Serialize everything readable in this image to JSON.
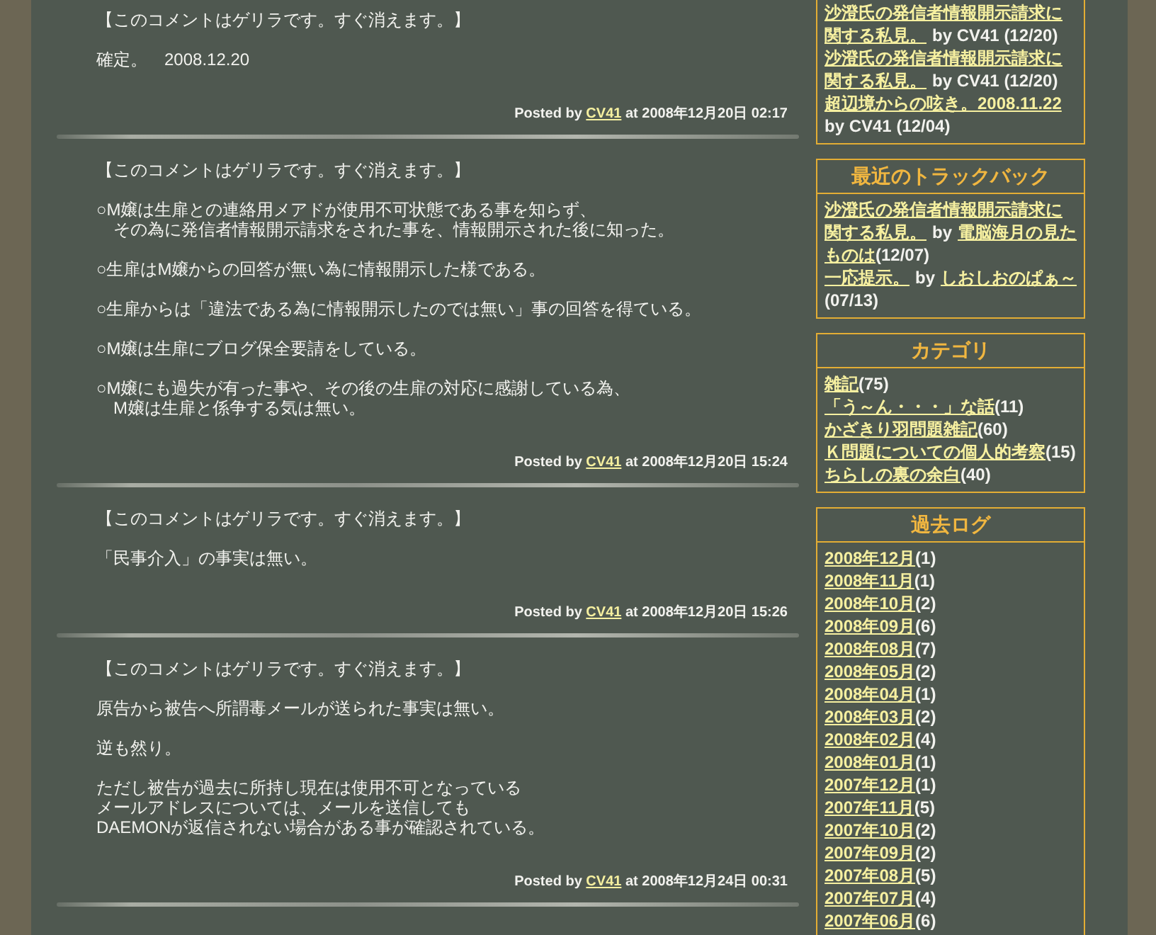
{
  "comments": [
    {
      "paragraphs": [
        [
          "【このコメントはゲリラです。すぐ消えます。】"
        ],
        [
          "確定。　2008.12.20"
        ]
      ],
      "footer": {
        "prefix": "Posted by",
        "author": "CV41",
        "suffix": "at 2008年12月20日 02:17"
      }
    },
    {
      "paragraphs": [
        [
          "【このコメントはゲリラです。すぐ消えます。】"
        ],
        [
          "○M嬢は生扉との連絡用メアドが使用不可状態である事を知らず、",
          "　その為に発信者情報開示請求をされた事を、情報開示された後に知った。"
        ],
        [
          "○生扉はM嬢からの回答が無い為に情報開示した様である。"
        ],
        [
          "○生扉からは「違法である為に情報開示したのでは無い」事の回答を得ている。"
        ],
        [
          "○M嬢は生扉にブログ保全要請をしている。"
        ],
        [
          "○M嬢にも過失が有った事や、その後の生扉の対応に感謝している為、",
          "　M嬢は生扉と係争する気は無い。"
        ]
      ],
      "footer": {
        "prefix": "Posted by",
        "author": "CV41",
        "suffix": "at 2008年12月20日 15:24"
      }
    },
    {
      "paragraphs": [
        [
          "【このコメントはゲリラです。すぐ消えます。】"
        ],
        [
          "「民事介入」の事実は無い。"
        ]
      ],
      "footer": {
        "prefix": "Posted by",
        "author": "CV41",
        "suffix": "at 2008年12月20日 15:26"
      }
    },
    {
      "paragraphs": [
        [
          "【このコメントはゲリラです。すぐ消えます。】"
        ],
        [
          "原告から被告へ所謂毒メールが送られた事実は無い。"
        ],
        [
          "逆も然り。"
        ],
        [
          "ただし被告が過去に所持し現在は使用不可となっている",
          "メールアドレスについては、メールを送信しても",
          "DAEMONが返信されない場合がある事が確認されている。"
        ]
      ],
      "footer": {
        "prefix": "Posted by",
        "author": "CV41",
        "suffix": "at 2008年12月24日 00:31"
      }
    }
  ],
  "sidebar": {
    "recent_comments": [
      {
        "lines": [
          [
            {
              "kind": "link",
              "text": "沙澄氏の発信者情報開示請求に"
            }
          ],
          [
            {
              "kind": "link",
              "text": "関する私見。"
            },
            {
              "kind": "text",
              "text": "by CV41 (12/20)"
            }
          ]
        ]
      },
      {
        "lines": [
          [
            {
              "kind": "link",
              "text": "沙澄氏の発信者情報開示請求に"
            }
          ],
          [
            {
              "kind": "link",
              "text": "関する私見。"
            },
            {
              "kind": "text",
              "text": "by CV41 (12/20)"
            }
          ]
        ]
      },
      {
        "lines": [
          [
            {
              "kind": "link",
              "text": "超辺境からの呟き。2008.11.22"
            }
          ],
          [
            {
              "kind": "text",
              "text": "by CV41 (12/04)"
            }
          ]
        ]
      }
    ],
    "trackbacks": {
      "title": "最近のトラックバック",
      "items": [
        {
          "lines": [
            [
              {
                "kind": "link",
                "text": "沙澄氏の発信者情報開示請求に"
              }
            ],
            [
              {
                "kind": "link",
                "text": "関する私見。"
              },
              {
                "kind": "text",
                "text": "by"
              },
              {
                "kind": "link",
                "text": "電脳海月の見た"
              }
            ],
            [
              {
                "kind": "link",
                "text": "ものは"
              },
              {
                "kind": "date",
                "text": "(12/07)"
              }
            ]
          ]
        },
        {
          "lines": [
            [
              {
                "kind": "link",
                "text": "一応提示。"
              },
              {
                "kind": "text",
                "text": "by"
              },
              {
                "kind": "link",
                "text": "しおしおのぱぁ～"
              }
            ],
            [
              {
                "kind": "date",
                "text": "(07/13)"
              }
            ]
          ]
        }
      ]
    },
    "categories": {
      "title": "カテゴリ",
      "items": [
        {
          "name": "雑記",
          "count": "(75)"
        },
        {
          "name": "「う～ん・・・」な話",
          "count": "(11)"
        },
        {
          "name": "かざきり羽問題雑記",
          "count": "(60)"
        },
        {
          "name": "Ｋ問題についての個人的考察",
          "count": "(15)"
        },
        {
          "name": "ちらしの裏の余白",
          "count": "(40)"
        }
      ]
    },
    "archives": {
      "title": "過去ログ",
      "items": [
        {
          "month": "2008年12月",
          "count": "(1)"
        },
        {
          "month": "2008年11月",
          "count": "(1)"
        },
        {
          "month": "2008年10月",
          "count": "(2)"
        },
        {
          "month": "2008年09月",
          "count": "(6)"
        },
        {
          "month": "2008年08月",
          "count": "(7)"
        },
        {
          "month": "2008年05月",
          "count": "(2)"
        },
        {
          "month": "2008年04月",
          "count": "(1)"
        },
        {
          "month": "2008年03月",
          "count": "(2)"
        },
        {
          "month": "2008年02月",
          "count": "(4)"
        },
        {
          "month": "2008年01月",
          "count": "(1)"
        },
        {
          "month": "2007年12月",
          "count": "(1)"
        },
        {
          "month": "2007年11月",
          "count": "(5)"
        },
        {
          "month": "2007年10月",
          "count": "(2)"
        },
        {
          "month": "2007年09月",
          "count": "(2)"
        },
        {
          "month": "2007年08月",
          "count": "(5)"
        },
        {
          "month": "2007年07月",
          "count": "(4)"
        },
        {
          "month": "2007年06月",
          "count": "(6)"
        }
      ]
    }
  }
}
